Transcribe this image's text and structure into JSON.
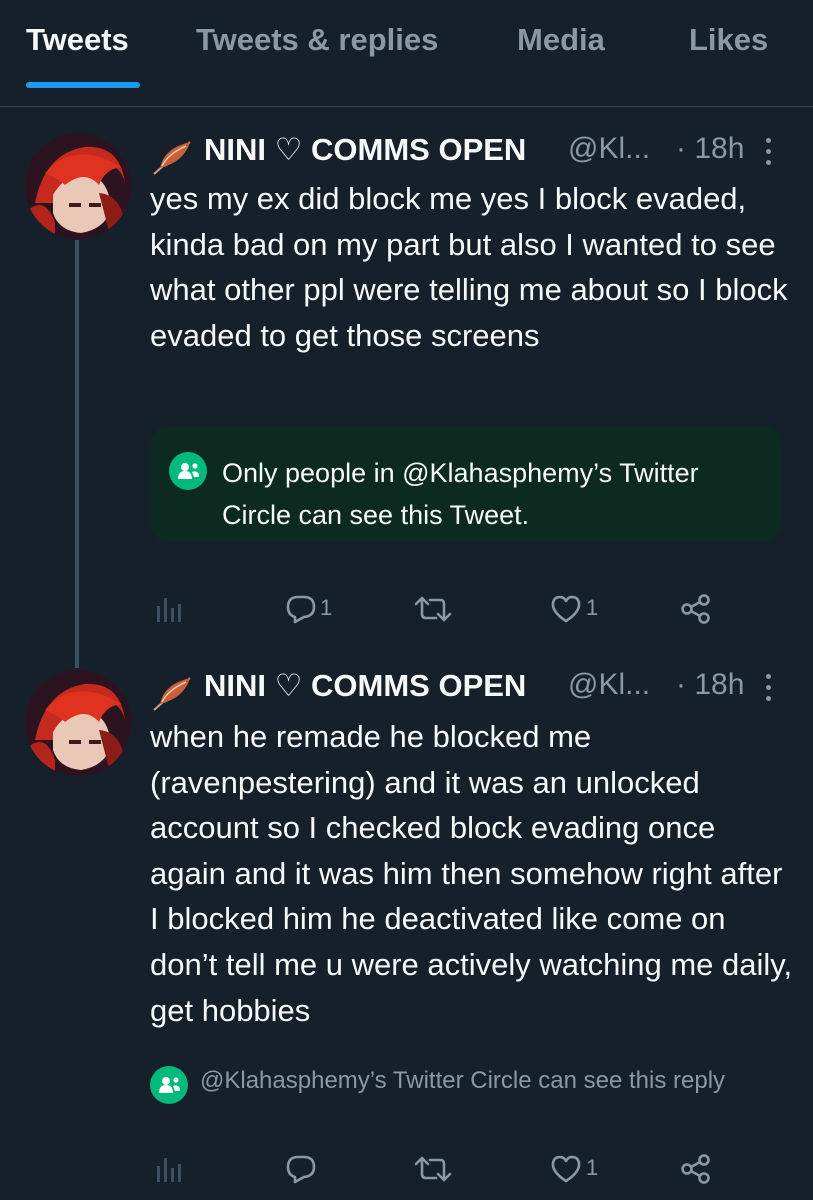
{
  "tabs": [
    {
      "label": "Tweets",
      "active": true
    },
    {
      "label": "Tweets & replies",
      "active": false
    },
    {
      "label": "Media",
      "active": false
    },
    {
      "label": "Likes",
      "active": false
    }
  ],
  "tweets": [
    {
      "name": "NINI ♡ COMMS OPEN",
      "handle": "@Kl...",
      "time": "· 18h",
      "text": "yes my ex did block me yes I block evaded, kinda bad on my part but also I wanted to see what other ppl were telling me about so I block evaded to get those screens",
      "circle_notice": "Only people in @Klahasphemy’s Twitter Circle can see this Tweet.",
      "reply_count": "1",
      "retweet_count": "",
      "like_count": "1"
    },
    {
      "name": "NINI ♡ COMMS OPEN",
      "handle": "@Kl...",
      "time": "· 18h",
      "text": "when he remade he blocked me (ravenpestering) and it was an unlocked account so I checked block evading once again and it was him then somehow right after I blocked him he deactivated like come on don’t tell me u were actively watching me daily, get hobbies",
      "circle_notice": "@Klahasphemy’s Twitter Circle can see this reply",
      "reply_count": "",
      "retweet_count": "",
      "like_count": "1"
    }
  ],
  "icons": {
    "name_prefix": "feather-icon",
    "analytics": "analytics-icon",
    "reply": "reply-icon",
    "retweet": "retweet-icon",
    "like": "heart-icon",
    "share": "share-icon",
    "circle": "twitter-circle-icon",
    "more": "more-vertical-icon"
  },
  "colors": {
    "background": "#15202b",
    "accent": "#1d9bf0",
    "circle_green": "#00ba7c",
    "circle_box_bg": "#0c2a1f",
    "muted": "#8b98a5"
  }
}
